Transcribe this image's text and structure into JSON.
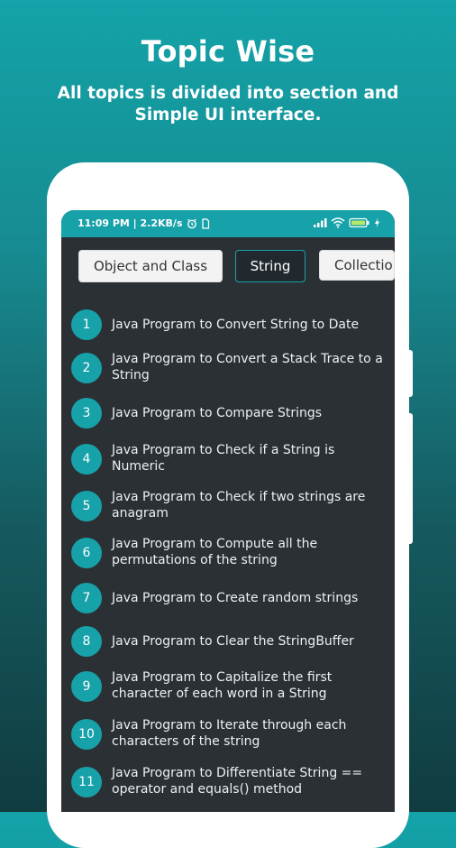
{
  "header": {
    "title": "Topic Wise",
    "subtitle": "All topics is divided into section and Simple UI interface."
  },
  "status_bar": {
    "time_info": "11:09 PM | 2.2KB/s",
    "icons": [
      "alarm-icon",
      "sim-icon",
      "signal-icon",
      "wifi-icon",
      "battery-icon",
      "charging-icon"
    ]
  },
  "tabs": [
    {
      "label": "Object and Class",
      "selected": false
    },
    {
      "label": "String",
      "selected": true
    },
    {
      "label": "Collectio",
      "selected": false
    }
  ],
  "programs": [
    {
      "num": "1",
      "title": "Java Program to Convert String to Date"
    },
    {
      "num": "2",
      "title": "Java Program to Convert a Stack Trace to a String"
    },
    {
      "num": "3",
      "title": "Java Program to Compare Strings"
    },
    {
      "num": "4",
      "title": "Java Program to Check if a String is Numeric"
    },
    {
      "num": "5",
      "title": "Java Program to Check if two strings are anagram"
    },
    {
      "num": "6",
      "title": "Java Program to Compute all the permutations of the string"
    },
    {
      "num": "7",
      "title": "Java Program to Create random strings"
    },
    {
      "num": "8",
      "title": "Java Program to Clear the StringBuffer"
    },
    {
      "num": "9",
      "title": "Java Program to Capitalize the first character of each word in a String"
    },
    {
      "num": "10",
      "title": "Java Program to Iterate through each characters of the string"
    },
    {
      "num": "11",
      "title": "Java Program to Differentiate String == operator and equals() method"
    }
  ],
  "colors": {
    "accent": "#17a1a9",
    "screen_bg": "#2b3035"
  }
}
